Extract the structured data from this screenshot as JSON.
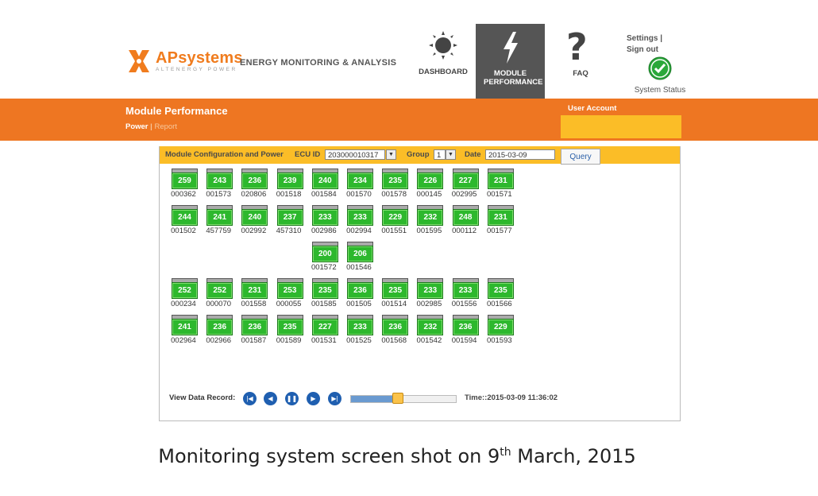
{
  "header": {
    "brand_prefix": "AP",
    "brand_suffix": "systems",
    "brand_sub": "ALTENERGY POWER",
    "tagline": "ENERGY MONITORING & ANALYSIS",
    "nav": [
      {
        "label": "DASHBOARD",
        "icon": "sun-icon"
      },
      {
        "label": "MODULE PERFORMANCE",
        "icon": "lightning-icon",
        "active": true
      },
      {
        "label": "FAQ",
        "icon": "question-icon"
      }
    ],
    "settings_label": "Settings |",
    "signout_label": "Sign out",
    "status_label": "System Status"
  },
  "banner": {
    "title": "Module Performance",
    "power_link": "Power",
    "report_link": "Report",
    "user_account_label": "User Account",
    "user_account_value": ""
  },
  "toolbar": {
    "title": "Module Configuration and Power",
    "ecu_label": "ECU ID",
    "ecu_value": "203000010317",
    "group_label": "Group",
    "group_value": "1",
    "date_label": "Date",
    "date_value": "2015-03-09",
    "query_label": "Query"
  },
  "modules": [
    [
      {
        "p": "259",
        "id": "000362",
        "c": 0
      },
      {
        "p": "243",
        "id": "001573",
        "c": 1
      },
      {
        "p": "236",
        "id": "020806",
        "c": 2
      },
      {
        "p": "239",
        "id": "001518",
        "c": 3
      },
      {
        "p": "240",
        "id": "001584",
        "c": 4
      },
      {
        "p": "234",
        "id": "001570",
        "c": 5
      },
      {
        "p": "235",
        "id": "001578",
        "c": 6
      },
      {
        "p": "226",
        "id": "000145",
        "c": 7
      },
      {
        "p": "227",
        "id": "002995",
        "c": 8
      },
      {
        "p": "231",
        "id": "001571",
        "c": 9
      }
    ],
    [
      {
        "p": "244",
        "id": "001502",
        "c": 0
      },
      {
        "p": "241",
        "id": "457759",
        "c": 1
      },
      {
        "p": "240",
        "id": "002992",
        "c": 2
      },
      {
        "p": "237",
        "id": "457310",
        "c": 3
      },
      {
        "p": "233",
        "id": "002986",
        "c": 4
      },
      {
        "p": "233",
        "id": "002994",
        "c": 5
      },
      {
        "p": "229",
        "id": "001551",
        "c": 6
      },
      {
        "p": "232",
        "id": "001595",
        "c": 7
      },
      {
        "p": "248",
        "id": "000112",
        "c": 8
      },
      {
        "p": "231",
        "id": "001577",
        "c": 9
      }
    ],
    [
      {
        "p": "200",
        "id": "001572",
        "c": 4
      },
      {
        "p": "206",
        "id": "001546",
        "c": 5
      }
    ],
    [
      {
        "p": "252",
        "id": "000234",
        "c": 0
      },
      {
        "p": "252",
        "id": "000070",
        "c": 1
      },
      {
        "p": "231",
        "id": "001558",
        "c": 2
      },
      {
        "p": "253",
        "id": "000055",
        "c": 3
      },
      {
        "p": "235",
        "id": "001585",
        "c": 4
      },
      {
        "p": "236",
        "id": "001505",
        "c": 5
      },
      {
        "p": "235",
        "id": "001514",
        "c": 6
      },
      {
        "p": "233",
        "id": "002985",
        "c": 7
      },
      {
        "p": "233",
        "id": "001556",
        "c": 8
      },
      {
        "p": "235",
        "id": "001566",
        "c": 9
      }
    ],
    [
      {
        "p": "241",
        "id": "002964",
        "c": 0
      },
      {
        "p": "236",
        "id": "002966",
        "c": 1
      },
      {
        "p": "236",
        "id": "001587",
        "c": 2
      },
      {
        "p": "235",
        "id": "001589",
        "c": 3
      },
      {
        "p": "227",
        "id": "001531",
        "c": 4
      },
      {
        "p": "233",
        "id": "001525",
        "c": 5
      },
      {
        "p": "236",
        "id": "001568",
        "c": 6
      },
      {
        "p": "232",
        "id": "001542",
        "c": 7
      },
      {
        "p": "236",
        "id": "001594",
        "c": 8
      },
      {
        "p": "229",
        "id": "001593",
        "c": 9
      }
    ]
  ],
  "playback": {
    "label": "View Data Record:",
    "progress": 0.45,
    "time_label": "Time::2015-03-09 11:36:02"
  },
  "caption": {
    "text_before": "Monitoring system screen shot on 9",
    "sup": "th",
    "text_after": " March, 2015"
  },
  "colors": {
    "brand_orange": "#ee7622",
    "accent_yellow": "#fbbd27",
    "module_green": "#2db82d",
    "player_blue": "#1f5fb0"
  }
}
